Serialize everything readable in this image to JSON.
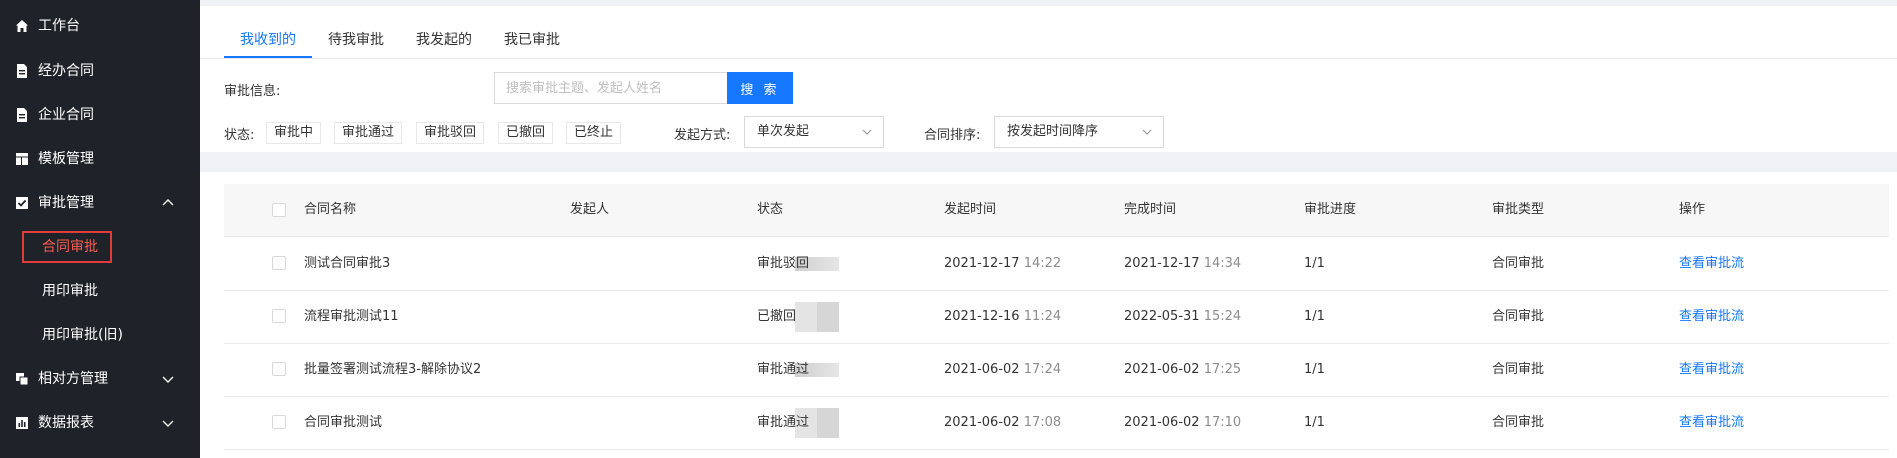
{
  "sidebar": {
    "items": [
      {
        "label": "工作台",
        "icon": "home-icon"
      },
      {
        "label": "经办合同",
        "icon": "document-icon"
      },
      {
        "label": "企业合同",
        "icon": "document-icon"
      },
      {
        "label": "模板管理",
        "icon": "template-icon"
      },
      {
        "label": "审批管理",
        "icon": "approval-icon",
        "expanded": true
      },
      {
        "label": "相对方管理",
        "icon": "counterparty-icon"
      },
      {
        "label": "数据报表",
        "icon": "report-icon"
      }
    ],
    "subitems": [
      {
        "label": "合同审批",
        "active": true
      },
      {
        "label": "用印审批"
      },
      {
        "label": "用印审批(旧)"
      }
    ]
  },
  "tabs": [
    "我收到的",
    "待我审批",
    "我发起的",
    "我已审批"
  ],
  "filters": {
    "search_label": "审批信息:",
    "search_placeholder": "搜索审批主题、发起人姓名",
    "search_button": "搜 索",
    "status_label": "状态:",
    "status_options": [
      "审批中",
      "审批通过",
      "审批驳回",
      "已撤回",
      "已终止"
    ],
    "mode_label": "发起方式:",
    "mode_value": "单次发起",
    "sort_label": "合同排序:",
    "sort_value": "按发起时间降序"
  },
  "table": {
    "headers": [
      "合同名称",
      "发起人",
      "状态",
      "发起时间",
      "完成时间",
      "审批进度",
      "审批类型",
      "操作"
    ],
    "rows": [
      {
        "name": "测试合同审批3",
        "status": "审批驳回",
        "start_date": "2021-12-17",
        "start_time": "14:22",
        "end_date": "2021-12-17",
        "end_time": "14:34",
        "progress": "1/1",
        "type": "合同审批",
        "action": "查看审批流"
      },
      {
        "name": "流程审批测试11",
        "status": "已撤回",
        "start_date": "2021-12-16",
        "start_time": "11:24",
        "end_date": "2022-05-31",
        "end_time": "15:24",
        "progress": "1/1",
        "type": "合同审批",
        "action": "查看审批流"
      },
      {
        "name": "批量签署测试流程3-解除协议2",
        "status": "审批通过",
        "start_date": "2021-06-02",
        "start_time": "17:24",
        "end_date": "2021-06-02",
        "end_time": "17:25",
        "progress": "1/1",
        "type": "合同审批",
        "action": "查看审批流"
      },
      {
        "name": "合同审批测试",
        "status": "审批通过",
        "start_date": "2021-06-02",
        "start_time": "17:08",
        "end_date": "2021-06-02",
        "end_time": "17:10",
        "progress": "1/1",
        "type": "合同审批",
        "action": "查看审批流"
      }
    ]
  },
  "colors": {
    "accent": "#1677ff",
    "sidebar_bg": "#1f2329",
    "active_red": "#e23b3b"
  }
}
